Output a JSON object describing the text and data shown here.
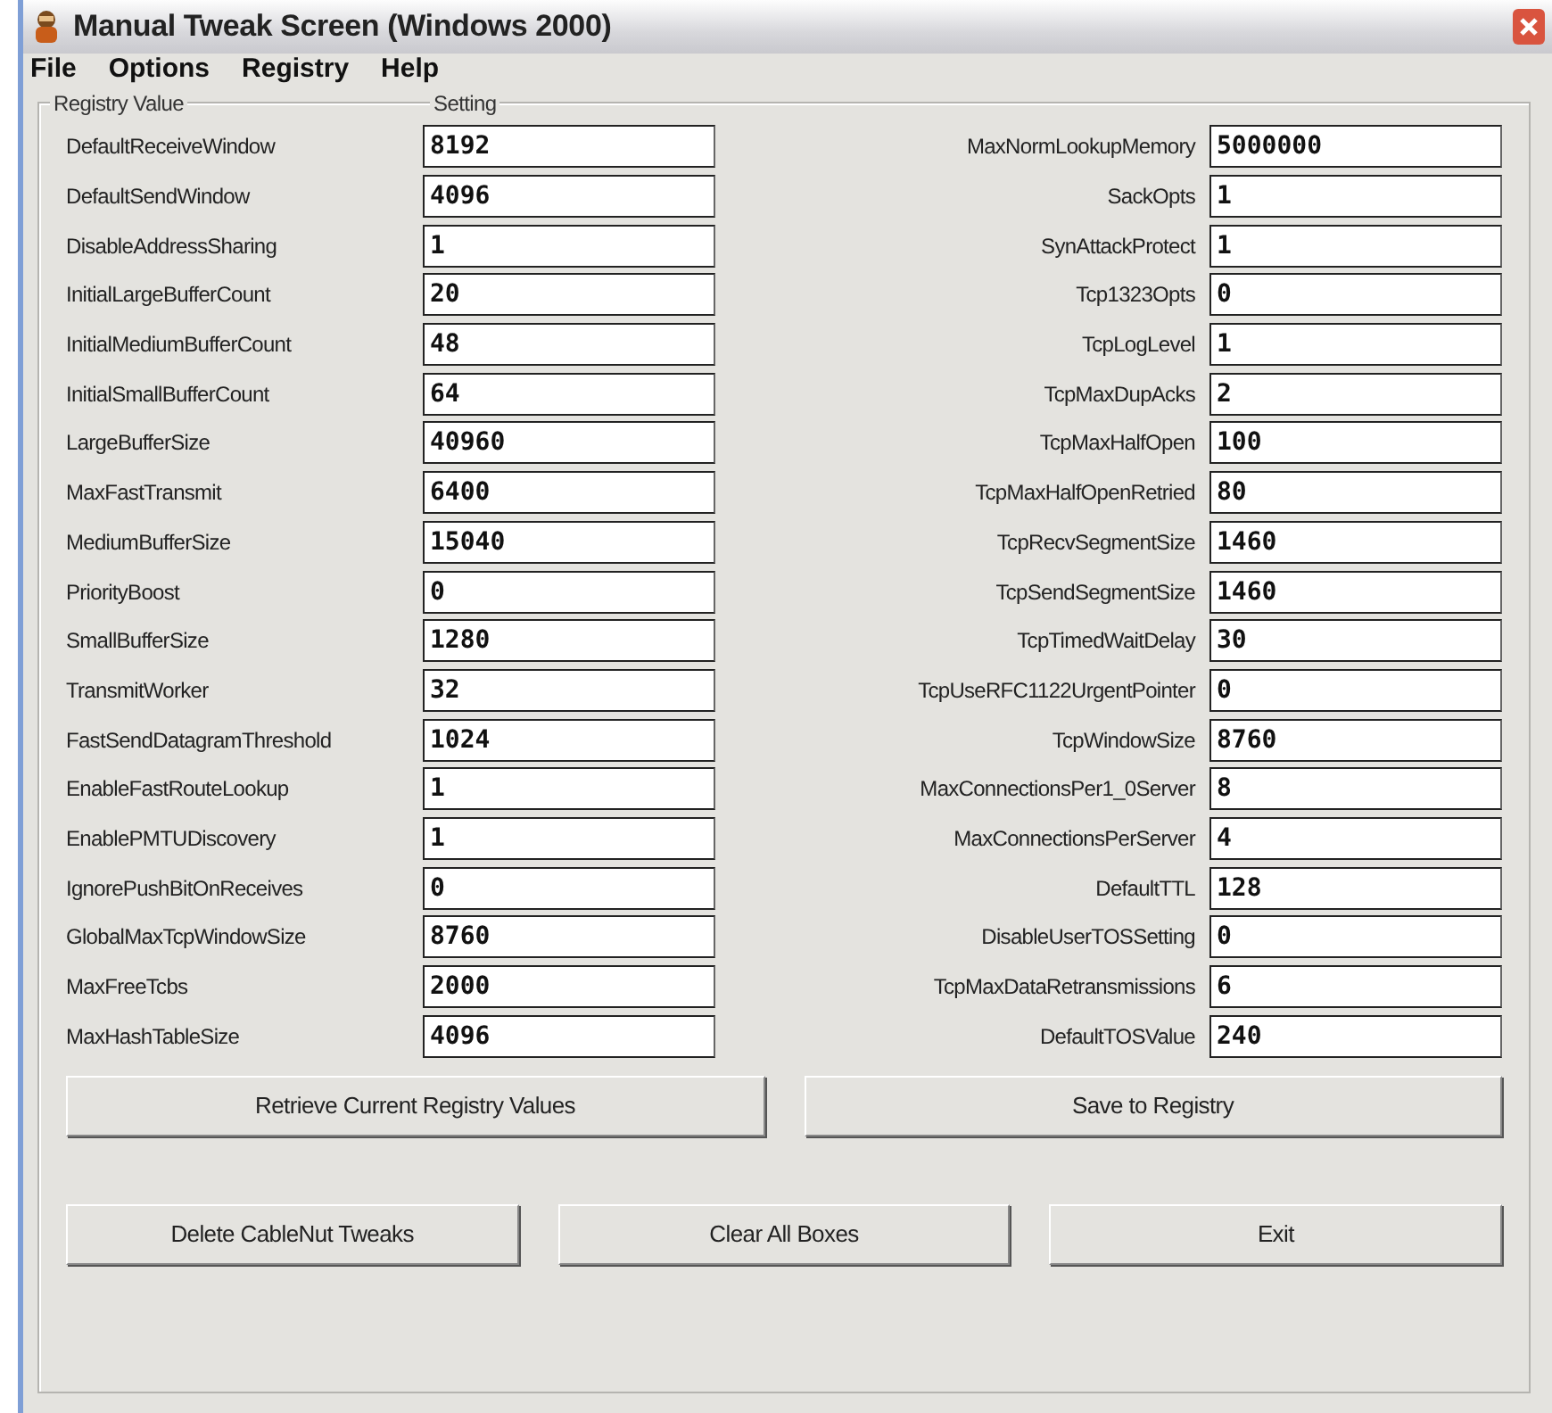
{
  "window": {
    "title": "Manual Tweak Screen (Windows 2000)"
  },
  "menu": [
    "File",
    "Options",
    "Registry",
    "Help"
  ],
  "group_headers": [
    "Registry Value",
    "Setting"
  ],
  "left_column": [
    {
      "name": "DefaultReceiveWindow",
      "value": "8192"
    },
    {
      "name": "DefaultSendWindow",
      "value": "4096"
    },
    {
      "name": "DisableAddressSharing",
      "value": "1"
    },
    {
      "name": "InitialLargeBufferCount",
      "value": "20"
    },
    {
      "name": "InitialMediumBufferCount",
      "value": "48"
    },
    {
      "name": "InitialSmallBufferCount",
      "value": "64"
    },
    {
      "name": "LargeBufferSize",
      "value": "40960"
    },
    {
      "name": "MaxFastTransmit",
      "value": "6400"
    },
    {
      "name": "MediumBufferSize",
      "value": "15040"
    },
    {
      "name": "PriorityBoost",
      "value": "0"
    },
    {
      "name": "SmallBufferSize",
      "value": "1280"
    },
    {
      "name": "TransmitWorker",
      "value": "32"
    },
    {
      "name": "FastSendDatagramThreshold",
      "value": "1024"
    },
    {
      "name": "EnableFastRouteLookup",
      "value": "1"
    },
    {
      "name": "EnablePMTUDiscovery",
      "value": "1"
    },
    {
      "name": "IgnorePushBitOnReceives",
      "value": "0"
    },
    {
      "name": "GlobalMaxTcpWindowSize",
      "value": "8760"
    },
    {
      "name": "MaxFreeTcbs",
      "value": "2000"
    },
    {
      "name": "MaxHashTableSize",
      "value": "4096"
    }
  ],
  "right_column": [
    {
      "name": "MaxNormLookupMemory",
      "value": "5000000"
    },
    {
      "name": "SackOpts",
      "value": "1"
    },
    {
      "name": "SynAttackProtect",
      "value": "1"
    },
    {
      "name": "Tcp1323Opts",
      "value": "0"
    },
    {
      "name": "TcpLogLevel",
      "value": "1"
    },
    {
      "name": "TcpMaxDupAcks",
      "value": "2"
    },
    {
      "name": "TcpMaxHalfOpen",
      "value": "100"
    },
    {
      "name": "TcpMaxHalfOpenRetried",
      "value": "80"
    },
    {
      "name": "TcpRecvSegmentSize",
      "value": "1460"
    },
    {
      "name": "TcpSendSegmentSize",
      "value": "1460"
    },
    {
      "name": "TcpTimedWaitDelay",
      "value": "30"
    },
    {
      "name": "TcpUseRFC1122UrgentPointer",
      "value": "0"
    },
    {
      "name": "TcpWindowSize",
      "value": "8760"
    },
    {
      "name": "MaxConnectionsPer1_0Server",
      "value": "8"
    },
    {
      "name": "MaxConnectionsPerServer",
      "value": "4"
    },
    {
      "name": "DefaultTTL",
      "value": "128"
    },
    {
      "name": "DisableUserTOSSetting",
      "value": "0"
    },
    {
      "name": "TcpMaxDataRetransmissions",
      "value": "6"
    },
    {
      "name": "DefaultTOSValue",
      "value": "240"
    }
  ],
  "button_rows": [
    [
      "Retrieve Current Registry Values",
      "Save to Registry"
    ],
    [
      "Delete CableNut Tweaks",
      "Clear All Boxes",
      "Exit"
    ]
  ]
}
